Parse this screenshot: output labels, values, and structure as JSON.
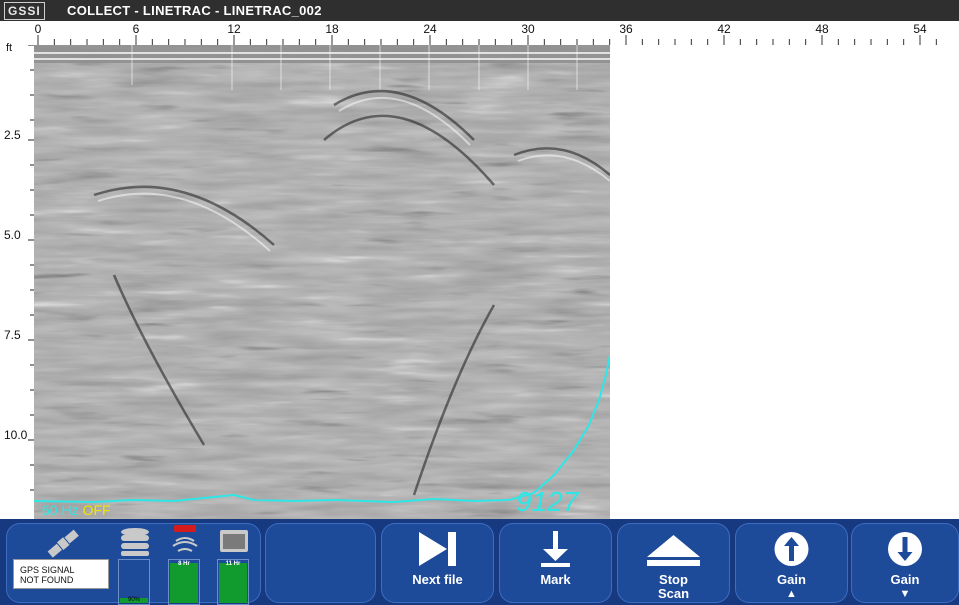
{
  "header": {
    "logo": "GSSI",
    "title": "COLLECT - LINETRAC - LINETRAC_002"
  },
  "distance_axis": {
    "labels": [
      "0",
      "6",
      "12",
      "18",
      "24",
      "30",
      "36",
      "42",
      "48",
      "54"
    ]
  },
  "depth_axis": {
    "unit": "ft",
    "labels": [
      "2.5",
      "5.0",
      "7.5",
      "10.0"
    ]
  },
  "overlay": {
    "frequency": "60 Hz",
    "frequency_state": "OFF",
    "signal_value": "9127",
    "trace_color": "#2fe6e6"
  },
  "status": {
    "gps_line1": "GPS SIGNAL",
    "gps_line2": "NOT FOUND",
    "storage_percent": "90%",
    "storage_level": 0.12,
    "battery1_label": "8 Hr",
    "battery1_level": 0.95,
    "battery2_label": "11 Hr",
    "battery2_level": 0.95
  },
  "buttons": {
    "next_file": "Next file",
    "mark": "Mark",
    "stop_line1": "Stop",
    "stop_line2": "Scan",
    "gain_up": "Gain",
    "gain_up_arrow": "▲",
    "gain_down": "Gain",
    "gain_down_arrow": "▼"
  },
  "colors": {
    "title_bar": "#2f2f2f",
    "bottom_bar": "#16397f",
    "button": "#1e4a9a",
    "battery_green": "#119a2e",
    "antenna_red": "#d51b1b"
  }
}
